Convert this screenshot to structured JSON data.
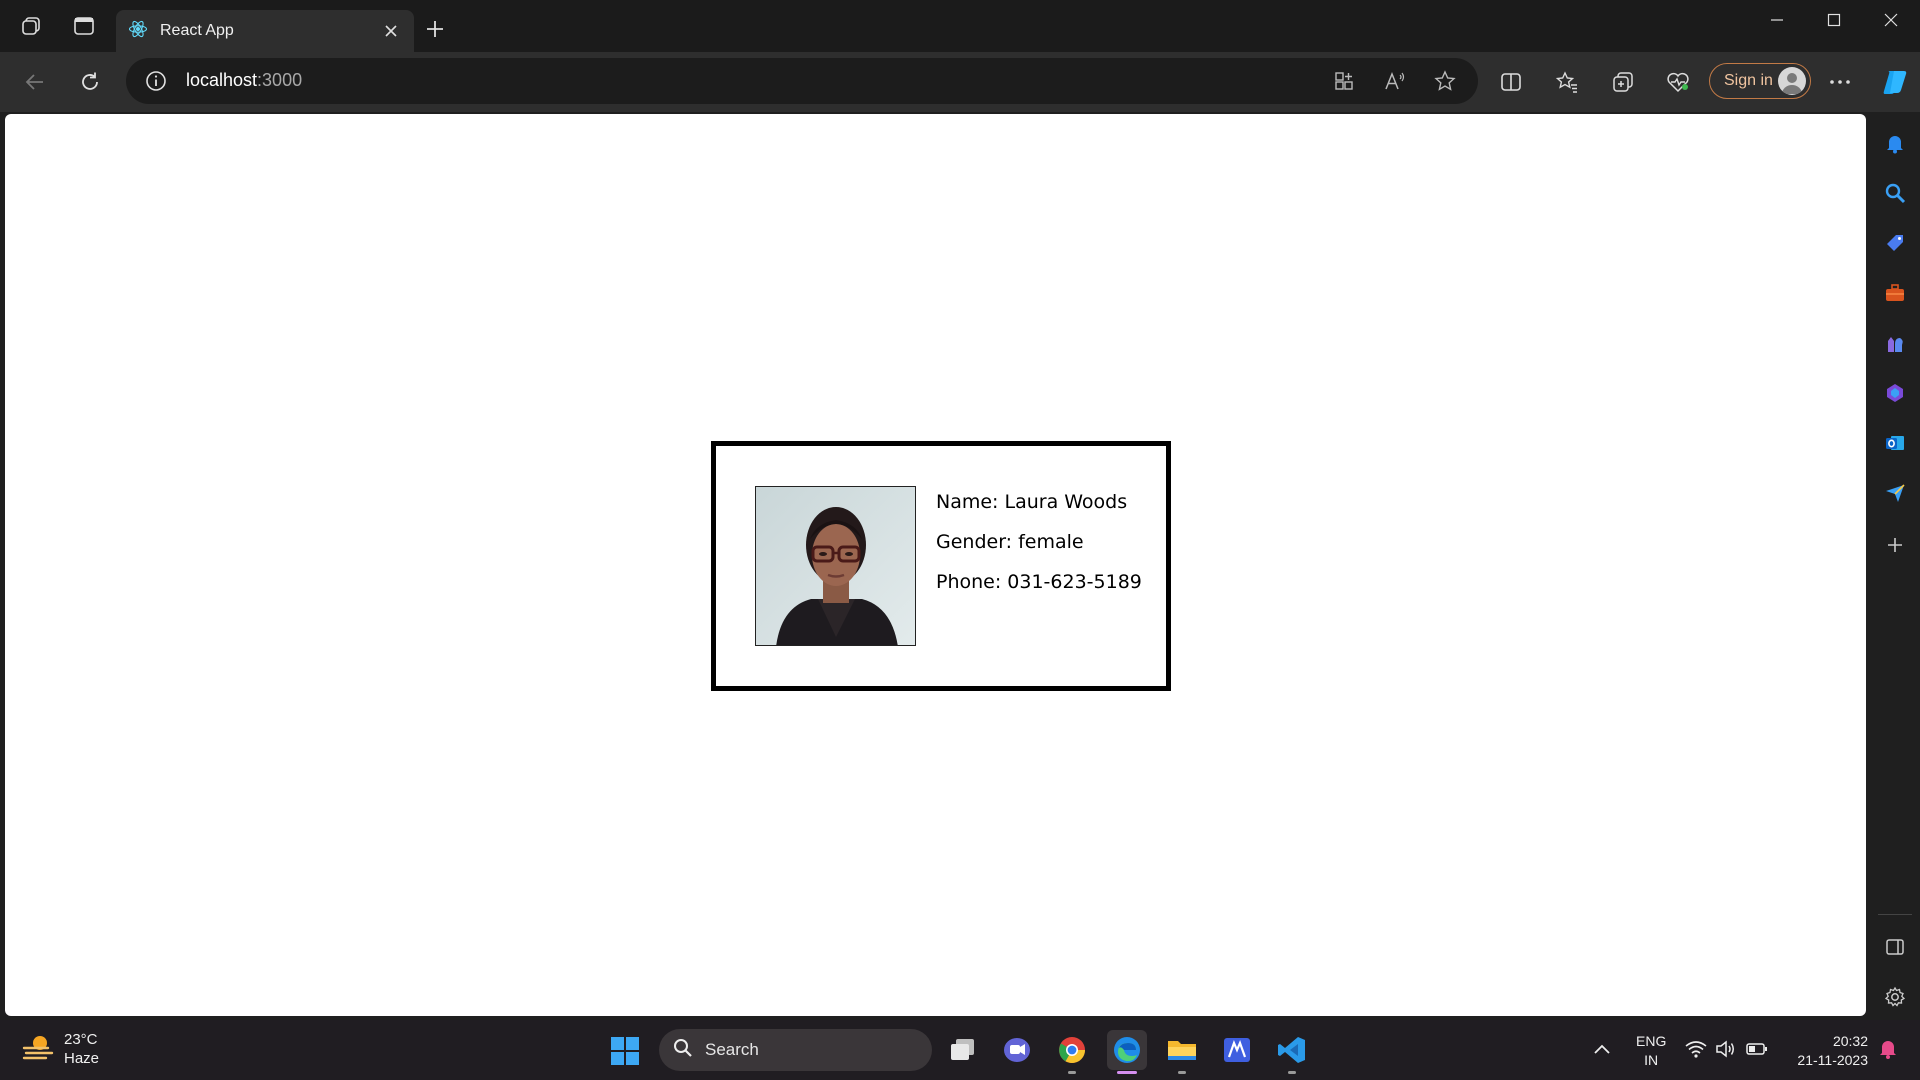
{
  "browser": {
    "tab": {
      "title": "React App"
    },
    "address": {
      "host": "localhost",
      "port": ":3000"
    },
    "sign_in_label": "Sign in"
  },
  "profile_card": {
    "name_line": "Name: Laura Woods",
    "gender_line": "Gender: female",
    "phone_line": "Phone: 031-623-5189"
  },
  "taskbar": {
    "weather": {
      "temp": "23°C",
      "condition": "Haze"
    },
    "search_placeholder": "Search",
    "language": {
      "line1": "ENG",
      "line2": "IN"
    },
    "clock": {
      "time": "20:32",
      "date": "21-11-2023"
    }
  },
  "colors": {
    "accent_signin": "#c27a46",
    "edge_blue": "#1f8de8",
    "vscode_blue": "#2a9ae8"
  }
}
